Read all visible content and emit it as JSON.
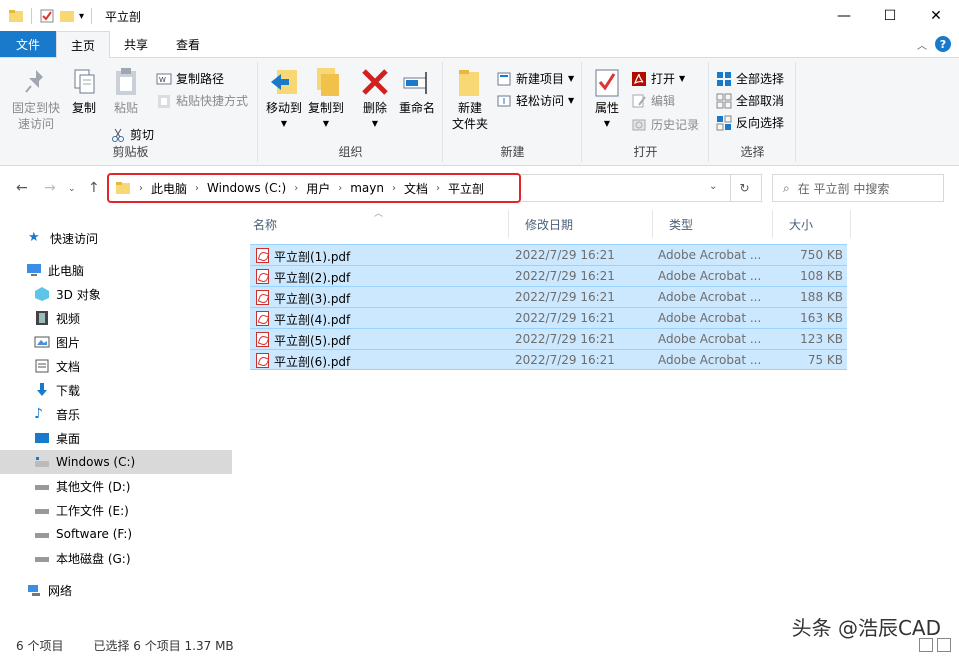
{
  "window": {
    "title": "平立剖",
    "controls": {
      "minimize": "—",
      "maximize": "☐",
      "close": "✕"
    }
  },
  "tabs": {
    "file": "文件",
    "home": "主页",
    "share": "共享",
    "view": "查看"
  },
  "ribbon": {
    "clipboard": {
      "label": "剪贴板",
      "pin": "固定到快\n速访问",
      "copy": "复制",
      "paste": "粘贴",
      "copy_path": "复制路径",
      "paste_shortcut": "粘贴快捷方式",
      "cut": "剪切"
    },
    "organize": {
      "label": "组织",
      "move_to": "移动到",
      "copy_to": "复制到",
      "delete": "删除",
      "rename": "重命名"
    },
    "new": {
      "label": "新建",
      "new_folder": "新建\n文件夹",
      "new_item": "新建项目",
      "easy_access": "轻松访问"
    },
    "open": {
      "label": "打开",
      "properties": "属性",
      "open": "打开",
      "edit": "编辑",
      "history": "历史记录"
    },
    "select": {
      "label": "选择",
      "select_all": "全部选择",
      "select_none": "全部取消",
      "invert": "反向选择"
    }
  },
  "address": {
    "crumbs": [
      "此电脑",
      "Windows (C:)",
      "用户",
      "mayn",
      "文档",
      "平立剖"
    ],
    "search_placeholder": "在 平立剖 中搜索"
  },
  "nav": {
    "quick_access": "快速访问",
    "this_pc": "此电脑",
    "items": [
      "3D 对象",
      "视频",
      "图片",
      "文档",
      "下载",
      "音乐",
      "桌面",
      "Windows (C:)",
      "其他文件 (D:)",
      "工作文件 (E:)",
      "Software (F:)",
      "本地磁盘 (G:)"
    ],
    "network": "网络"
  },
  "columns": {
    "name": "名称",
    "date": "修改日期",
    "type": "类型",
    "size": "大小"
  },
  "files": [
    {
      "name": "平立剖(1).pdf",
      "date": "2022/7/29 16:21",
      "type": "Adobe Acrobat ...",
      "size": "750 KB"
    },
    {
      "name": "平立剖(2).pdf",
      "date": "2022/7/29 16:21",
      "type": "Adobe Acrobat ...",
      "size": "108 KB"
    },
    {
      "name": "平立剖(3).pdf",
      "date": "2022/7/29 16:21",
      "type": "Adobe Acrobat ...",
      "size": "188 KB"
    },
    {
      "name": "平立剖(4).pdf",
      "date": "2022/7/29 16:21",
      "type": "Adobe Acrobat ...",
      "size": "163 KB"
    },
    {
      "name": "平立剖(5).pdf",
      "date": "2022/7/29 16:21",
      "type": "Adobe Acrobat ...",
      "size": "123 KB"
    },
    {
      "name": "平立剖(6).pdf",
      "date": "2022/7/29 16:21",
      "type": "Adobe Acrobat ...",
      "size": "75 KB"
    }
  ],
  "status": {
    "count": "6 个项目",
    "selected": "已选择 6 个项目 1.37 MB"
  },
  "watermark": "头条 @浩辰CAD",
  "colors": {
    "accent": "#1979ca",
    "selection": "#cce8ff",
    "highlight_box": "#e0262b"
  }
}
